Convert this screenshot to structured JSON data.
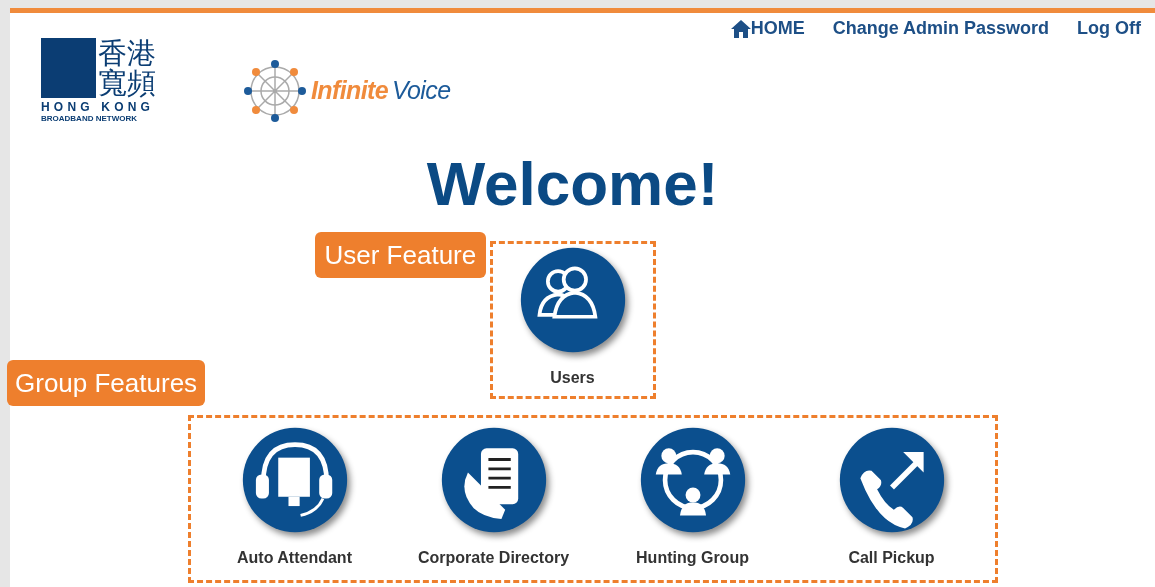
{
  "nav": [
    {
      "kind": "home",
      "label": "HOME"
    },
    {
      "kind": "link",
      "label": "Change Admin Password"
    },
    {
      "kind": "link",
      "label": "Log Off"
    }
  ],
  "logos": {
    "hkbn": {
      "chinese_top": "香港",
      "chinese_bottom": "寬頻",
      "english_top": "HONG KONG",
      "english_bottom": "BROADBAND NETWORK"
    },
    "product": {
      "first_word": "Infinite",
      "second_word": "Voice"
    }
  },
  "heading": "Welcome!",
  "user_section": {
    "callout": "User Feature",
    "features": [
      {
        "kind": "users",
        "label": "Users"
      }
    ]
  },
  "group_section": {
    "callout": "Group Features",
    "features": [
      {
        "kind": "attendant",
        "label": "Auto Attendant"
      },
      {
        "kind": "directory",
        "label": "Corporate Directory"
      },
      {
        "kind": "hunting",
        "label": "Hunting Group"
      },
      {
        "kind": "pickup",
        "label": "Call Pickup"
      }
    ]
  }
}
